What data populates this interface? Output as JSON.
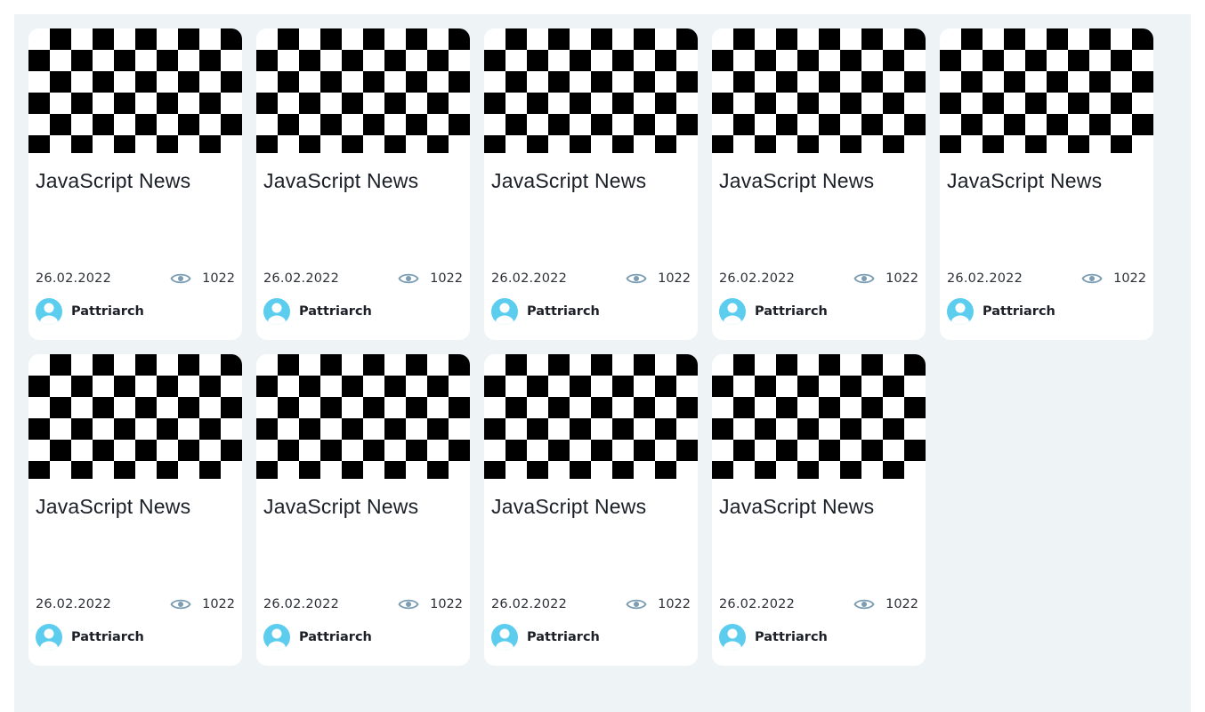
{
  "colors": {
    "panel_background": "#eef3f6",
    "card_background": "#ffffff",
    "avatar_blue": "#5ccdee",
    "eye_icon": "#7b9db3"
  },
  "icons": {
    "views": "eye-icon",
    "author": "user-avatar-icon"
  },
  "cards": [
    {
      "title": "JavaScript News",
      "date": "26.02.2022",
      "views": "1022",
      "author": "Pattriarch"
    },
    {
      "title": "JavaScript News",
      "date": "26.02.2022",
      "views": "1022",
      "author": "Pattriarch"
    },
    {
      "title": "JavaScript News",
      "date": "26.02.2022",
      "views": "1022",
      "author": "Pattriarch"
    },
    {
      "title": "JavaScript News",
      "date": "26.02.2022",
      "views": "1022",
      "author": "Pattriarch"
    },
    {
      "title": "JavaScript News",
      "date": "26.02.2022",
      "views": "1022",
      "author": "Pattriarch"
    },
    {
      "title": "JavaScript News",
      "date": "26.02.2022",
      "views": "1022",
      "author": "Pattriarch"
    },
    {
      "title": "JavaScript News",
      "date": "26.02.2022",
      "views": "1022",
      "author": "Pattriarch"
    },
    {
      "title": "JavaScript News",
      "date": "26.02.2022",
      "views": "1022",
      "author": "Pattriarch"
    },
    {
      "title": "JavaScript News",
      "date": "26.02.2022",
      "views": "1022",
      "author": "Pattriarch"
    }
  ]
}
